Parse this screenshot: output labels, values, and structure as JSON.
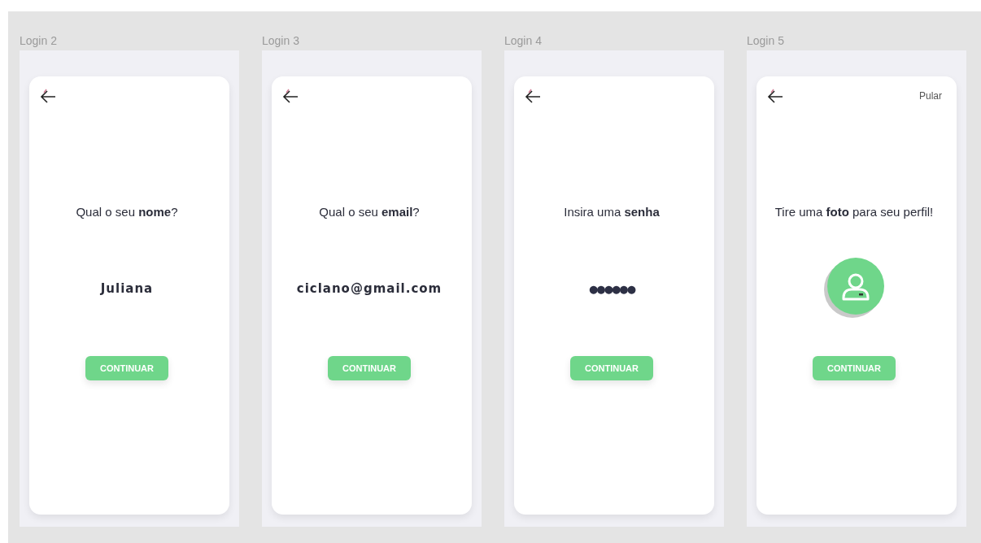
{
  "screens": [
    {
      "label": "Login 2",
      "title": "Qual o seu **nome**?",
      "kind": "text",
      "value": "Juliana",
      "button": "CONTINUAR"
    },
    {
      "label": "Login 3",
      "title": "Qual o seu **email**?",
      "kind": "text",
      "value": "ciclano@gmail.com",
      "button": "CONTINUAR"
    },
    {
      "label": "Login 4",
      "title": "Insira uma **senha**",
      "kind": "password",
      "value": "●●●●●●",
      "button": "CONTINUAR"
    },
    {
      "label": "Login 5",
      "title": "Tire uma **foto** para seu perfil!",
      "kind": "photo",
      "skip": "Pular",
      "button": "CONTINUAR"
    }
  ]
}
